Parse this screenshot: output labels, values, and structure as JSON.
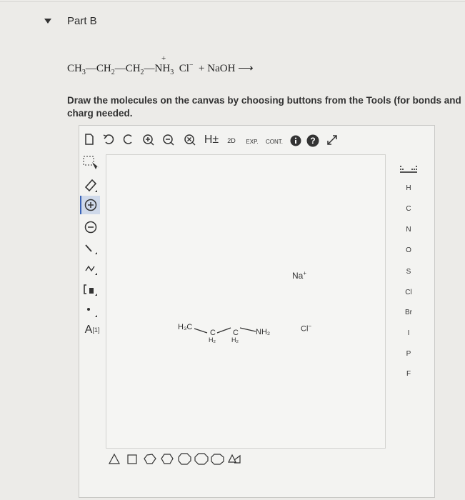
{
  "part": {
    "title": "Part B"
  },
  "equation": {
    "ch3": "CH",
    "sub3": "3",
    "ch2a": "CH",
    "sub2a": "2",
    "ch2b": "CH",
    "sub2b": "2",
    "nh": "NH",
    "subnh": "3",
    "plus": "+",
    "cl": "Cl",
    "clcharge": "−",
    "plussign": "+",
    "naoh": "NaOH",
    "arrow": "⟶",
    "dash": "—"
  },
  "prompt": "Draw the molecules on the canvas by choosing buttons from the Tools (for bonds and charg needed.",
  "toolbar": {
    "hplus_label": "H±",
    "twod_label": "2D",
    "exp_label": "EXP.",
    "cont_label": "CONT."
  },
  "side": {
    "atom_label": "A",
    "atom_sup": "[1]"
  },
  "elements": [
    "H",
    "C",
    "N",
    "O",
    "S",
    "Cl",
    "Br",
    "I",
    "P",
    "F"
  ],
  "molecules": {
    "na": "Na",
    "na_charge": "+",
    "cl": "Cl",
    "cl_charge": "−",
    "h3c": "H₃C",
    "c1": "C",
    "c2": "C",
    "h2a": "H₂",
    "h2b": "H₂",
    "nh2": "NH₂"
  }
}
